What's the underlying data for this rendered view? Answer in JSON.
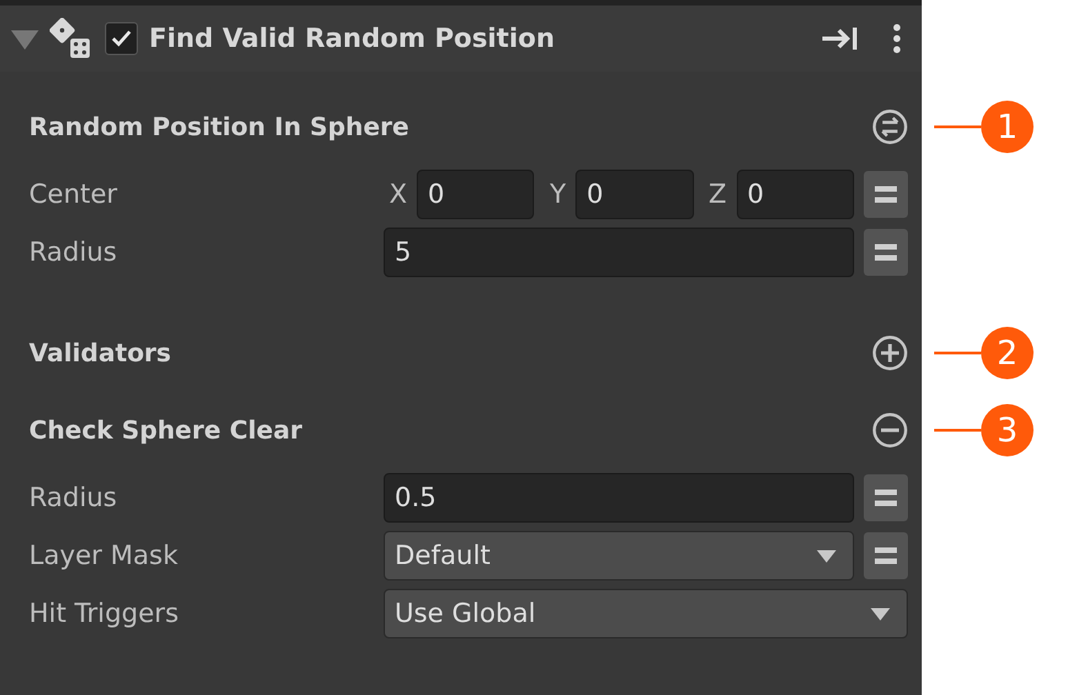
{
  "header": {
    "title": "Find Valid Random Position",
    "expanded": true,
    "enabled": true
  },
  "sections": [
    {
      "title": "Random Position In Sphere",
      "kind": "swap",
      "callout": "1",
      "rows": [
        {
          "kind": "vector",
          "label": "Center",
          "override_button": true,
          "axes": [
            {
              "axis": "X",
              "value": "0"
            },
            {
              "axis": "Y",
              "value": "0"
            },
            {
              "axis": "Z",
              "value": "0"
            }
          ]
        },
        {
          "kind": "number",
          "label": "Radius",
          "value": "5",
          "override_button": true
        }
      ]
    },
    {
      "title": "Validators",
      "kind": "add",
      "callout": "2"
    },
    {
      "title": "Check Sphere Clear",
      "kind": "remove",
      "callout": "3",
      "rows": [
        {
          "kind": "number",
          "label": "Radius",
          "value": "0.5",
          "override_button": true
        },
        {
          "kind": "dropdown",
          "label": "Layer Mask",
          "value": "Default",
          "override_button": true
        },
        {
          "kind": "dropdown",
          "label": "Hit Triggers",
          "value": "Use Global",
          "override_button": false
        }
      ]
    }
  ]
}
